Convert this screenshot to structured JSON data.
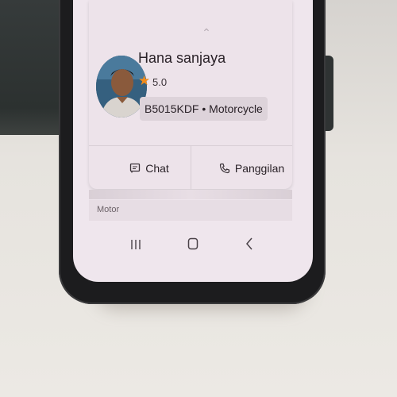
{
  "driver": {
    "name": "Hana sanjaya",
    "rating": "5.0",
    "vehicle": "B5015KDF • Motorcycle"
  },
  "actions": {
    "chat_label": "Chat",
    "call_label": "Panggilan"
  },
  "service": {
    "label": "Motor"
  },
  "icons": {
    "star": "star-icon",
    "chat": "chat-icon",
    "call": "phone-icon",
    "recent_apps": "recent-apps-icon",
    "home": "home-icon",
    "back": "back-icon"
  },
  "colors": {
    "star": "#f28c1b",
    "screen_background": "#efe6ed"
  }
}
